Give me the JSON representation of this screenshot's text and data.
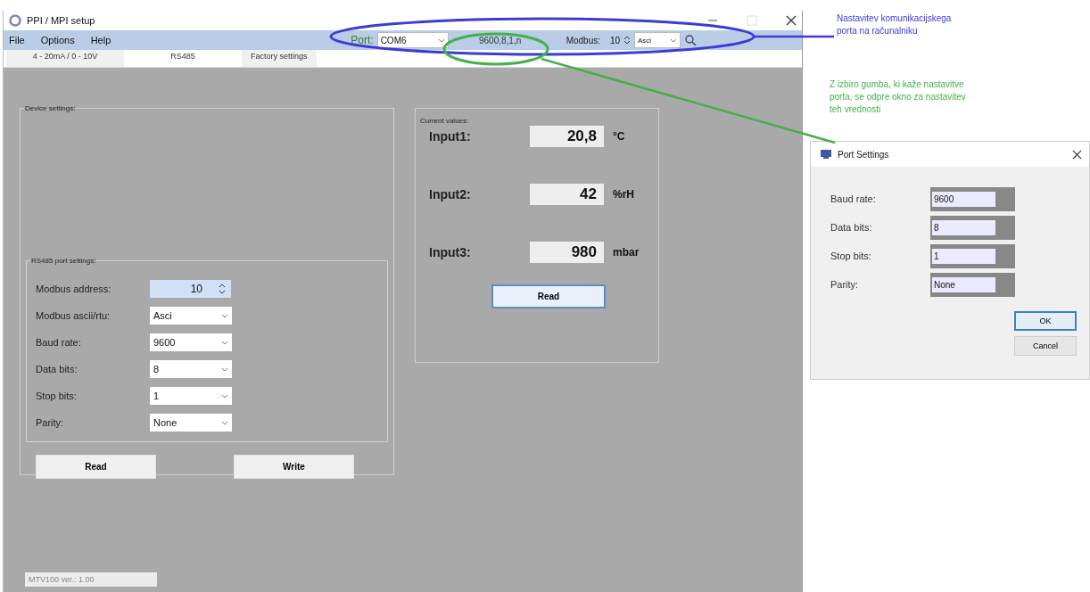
{
  "window": {
    "title": "PPI / MPI setup"
  },
  "menu": [
    "File",
    "Options",
    "Help"
  ],
  "toolbar": {
    "port_label": "Port:",
    "port": "COM6",
    "port_settings": "9600,8,1,n",
    "modbus_label": "Modbus:",
    "modbus_address": "10",
    "modbus_mode": "Asci"
  },
  "tabs": [
    {
      "label": "4 - 20mA / 0 - 10V",
      "selected": false
    },
    {
      "label": "RS485",
      "selected": true
    },
    {
      "label": "Factory settings",
      "selected": false
    }
  ],
  "device_settings": {
    "title": "Device settings:",
    "port_group": {
      "title": "RS485 port settings:",
      "fields": [
        {
          "kind": "spinner",
          "label": "Modbus address:",
          "value": "10"
        },
        {
          "kind": "dropdown",
          "label": "Modbus ascii/rtu:",
          "value": "Asci"
        },
        {
          "kind": "dropdown",
          "label": "Baud rate:",
          "value": "9600"
        },
        {
          "kind": "dropdown",
          "label": "Data bits:",
          "value": "8"
        },
        {
          "kind": "dropdown",
          "label": "Stop bits:",
          "value": "1"
        },
        {
          "kind": "dropdown",
          "label": "Parity:",
          "value": "None"
        }
      ]
    },
    "buttons": [
      "Read",
      "Write"
    ]
  },
  "current_values": {
    "title": "Current values:",
    "inputs": [
      {
        "label": "Input1:",
        "value": "20,8",
        "unit": "°C"
      },
      {
        "label": "Input2:",
        "value": "42",
        "unit": "%rH"
      },
      {
        "label": "Input3:",
        "value": "980",
        "unit": "mbar"
      }
    ],
    "button": "Read"
  },
  "status": "MTV100   ver.: 1.00",
  "annotations": [
    {
      "text": "Nastavitev komunikacijskega porta na računalniku",
      "color": "#3b3bd6"
    },
    {
      "text": "Z izbiro gumba, ki kaže nastavitve porta, se odpre okno za nastavitev teh vrednosti",
      "color": "#43b14b"
    }
  ],
  "dialog": {
    "title": "Port Settings",
    "fields": [
      {
        "label": "Baud rate:",
        "value": "9600"
      },
      {
        "label": "Data bits:",
        "value": "8"
      },
      {
        "label": "Stop bits:",
        "value": "1"
      },
      {
        "label": "Parity:",
        "value": "None"
      }
    ],
    "buttons": [
      "OK",
      "Cancel"
    ]
  }
}
